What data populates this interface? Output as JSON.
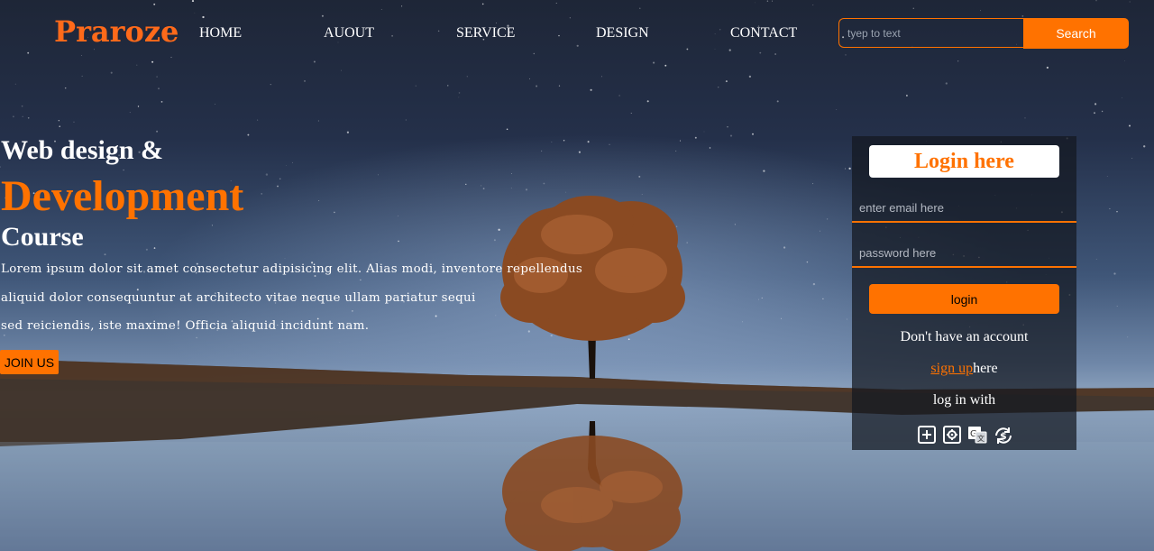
{
  "header": {
    "logo": "Praroze",
    "nav": [
      "HOME",
      "AUOUT",
      "SERVICE",
      "DESIGN",
      "CONTACT"
    ],
    "search": {
      "placeholder": "tyep to text",
      "button": "Search"
    }
  },
  "hero": {
    "line1": "Web design &",
    "line2": "Development",
    "line3": "Course",
    "paragraph_lines": [
      "Lorem ipsum dolor sit amet consectetur adipisicing elit. Alias modi, inventore repellendus",
      "aliquid dolor consequuntur at architecto vitae neque ullam pariatur sequi",
      "sed reiciendis, iste maxime! Officia aliquid incidunt nam."
    ],
    "join_button": "JOIN US"
  },
  "login": {
    "title": "Login here",
    "email_placeholder": "enter email here",
    "password_placeholder": "password here",
    "login_button": "login",
    "no_account": "Don't have an account",
    "signup_link": "sign up",
    "signup_suffix": "here",
    "login_with": "log in with",
    "social_icons": [
      "plus-square-icon",
      "gear-square-icon",
      "translate-icon",
      "refresh-dollar-icon"
    ]
  },
  "colors": {
    "accent": "#ff7200",
    "logo": "#ff6a1a"
  }
}
